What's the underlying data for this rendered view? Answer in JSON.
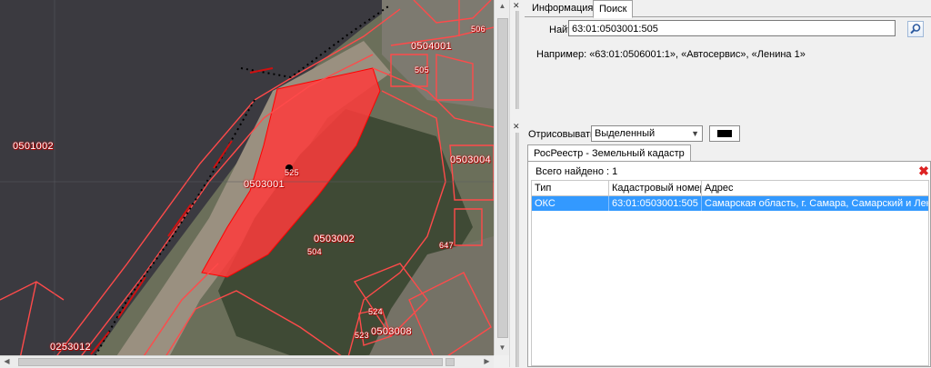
{
  "map": {
    "labels": {
      "l1": "0504001",
      "l2": "0501002",
      "l3": "0503001",
      "l4": "0503002",
      "l5": "0503004",
      "l6": "0503008",
      "l7": "0253012",
      "l8": "506",
      "l9": "505",
      "l10": "504",
      "l11": "524",
      "l12": "523",
      "l13": "647",
      "l14": "525"
    }
  },
  "panel": {
    "tabs": [
      "Информация",
      "Поиск"
    ],
    "search": {
      "label": "Найти:",
      "value": "63:01:0503001:505",
      "example": "Например: «63:01:0506001:1», «Автосервис», «Ленина 1»"
    },
    "render": {
      "label": "Отрисовывать",
      "selected": "Выделенный",
      "color": "#000000"
    },
    "results_tab": "РосРеестр - Земельный кадастр",
    "total_label": "Всего найдено :",
    "total_count": "1",
    "columns": [
      "Тип",
      "Кадастровый номер",
      "Адрес"
    ],
    "rows": [
      {
        "type": "ОКС",
        "cadastral": "63:01:0503001:505",
        "address": "Самарская область, г. Самара, Самарский и Ленинский р"
      }
    ]
  }
}
